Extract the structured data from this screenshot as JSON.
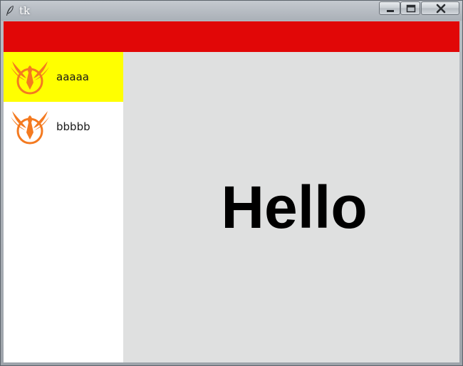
{
  "window": {
    "title": "tk",
    "app_icon": "feather-icon",
    "controls": {
      "minimize_icon": "minimize-icon",
      "maximize_icon": "maximize-icon",
      "close_icon": "close-icon"
    }
  },
  "topbar": {
    "color": "#e10707"
  },
  "sidebar": {
    "selected_color": "#ffff00",
    "items": [
      {
        "label": "aaaaa",
        "icon": "phoenix-logo-icon",
        "selected": true
      },
      {
        "label": "bbbbb",
        "icon": "phoenix-logo-icon",
        "selected": false
      }
    ]
  },
  "main": {
    "text": "Hello",
    "background": "#dfe0e0"
  }
}
